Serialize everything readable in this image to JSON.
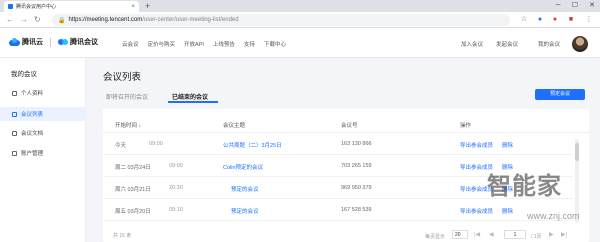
{
  "browser": {
    "tab_title": "腾讯会议用户中心",
    "tab_close": "×",
    "new_tab": "+",
    "window_controls": [
      "─",
      "☐",
      "✕"
    ],
    "url_host": "https://meeting.tencent.com",
    "url_path": "/user-center/user-meeting-list/ended",
    "nav_icons": [
      "back-icon",
      "forward-icon",
      "reload-icon"
    ]
  },
  "header": {
    "brand_cloud": "腾讯云",
    "brand_meeting": "腾讯会议",
    "nav": [
      "云会议",
      "定价与购买",
      "开放API",
      "上线预告",
      "支持",
      "下载中心"
    ],
    "join_meeting": "加入会议",
    "start_meeting": "发起会议",
    "my_meetings": "我的会议"
  },
  "sidebar": {
    "title": "我的会议",
    "items": [
      {
        "label": "个人资料",
        "icon": "user-icon",
        "active": false
      },
      {
        "label": "会议列表",
        "icon": "list-icon",
        "active": true
      },
      {
        "label": "会议文档",
        "icon": "document-icon",
        "active": false
      },
      {
        "label": "账户管理",
        "icon": "account-icon",
        "active": false
      }
    ]
  },
  "main": {
    "title": "会议列表",
    "tabs": [
      {
        "label": "即将召开的会议",
        "active": false
      },
      {
        "label": "已结束的会议",
        "active": true
      }
    ],
    "primary_button": "预定会议",
    "table": {
      "headers": {
        "time": "开始时间 ↓",
        "topic": "会议主题",
        "number": "会议号",
        "actions": "操作"
      },
      "rows": [
        {
          "date": "今天",
          "time": "09:00",
          "topic": "公共周题（二）3月25日",
          "number": "163 130 866",
          "action1": "导出参会成员",
          "action2": "删除"
        },
        {
          "date": "周二 03月24日",
          "time": "09:00",
          "topic": "Colin预定的会议",
          "number": "703 265 159",
          "action1": "导出参会成员",
          "action2": "删除"
        },
        {
          "date": "周六 03月21日",
          "time": "20:30",
          "topic": "预定的会议",
          "number": "969 950 379",
          "action1": "导出参会成员",
          "action2": "删除"
        },
        {
          "date": "周五 03月20日",
          "time": "09:10",
          "topic": "预定的会议",
          "number": "167 528 539",
          "action1": "导出参会成员",
          "action2": "删除"
        }
      ]
    },
    "pagination": {
      "total": "共 15 条",
      "per_page_label": "每页显示",
      "per_page": "20",
      "current_page": "1",
      "page_total": "/ 1页"
    }
  },
  "watermark": {
    "text": "智能家",
    "url": "www.znj.com"
  },
  "colors": {
    "accent": "#1e6fff",
    "sidebar_active_bg": "#eaf2ff"
  }
}
